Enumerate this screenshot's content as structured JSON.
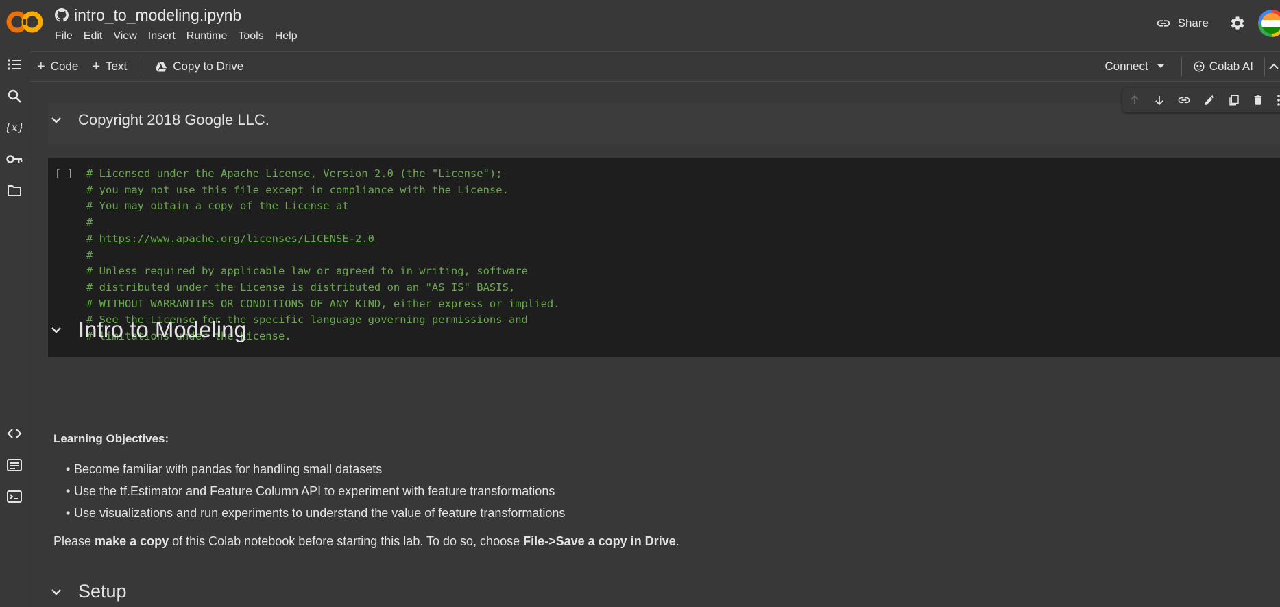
{
  "app": {
    "notebook_title": "intro_to_modeling.ipynb",
    "logo_text": "CO",
    "menu": [
      "File",
      "Edit",
      "View",
      "Insert",
      "Runtime",
      "Tools",
      "Help"
    ],
    "share_label": "Share"
  },
  "toolbar": {
    "code_label": "Code",
    "text_label": "Text",
    "copy_to_drive_label": "Copy to Drive",
    "connect_label": "Connect",
    "colab_ai_label": "Colab AI"
  },
  "rail": [
    "table-of-contents-icon",
    "search-icon",
    "variables-icon",
    "secrets-key-icon",
    "files-folder-icon",
    "code-snippets-icon",
    "command-palette-icon",
    "terminal-icon"
  ],
  "cells": {
    "copyright_heading": "Copyright 2018 Google LLC.",
    "run_indicator": "[ ]",
    "code_lines": [
      "# Licensed under the Apache License, Version 2.0 (the \"License\");",
      "# you may not use this file except in compliance with the License.",
      "# You may obtain a copy of the License at",
      "#",
      "# https://www.apache.org/licenses/LICENSE-2.0",
      "#",
      "# Unless required by applicable law or agreed to in writing, software",
      "# distributed under the License is distributed on an \"AS IS\" BASIS,",
      "# WITHOUT WARRANTIES OR CONDITIONS OF ANY KIND, either express or implied.",
      "# See the License for the specific language governing permissions and",
      "# limitations under the License."
    ],
    "intro_heading": "Intro to Modeling",
    "objectives_label": "Learning Objectives:",
    "objectives": [
      "Become familiar with pandas for handling small datasets",
      "Use the tf.Estimator and Feature Column API to experiment with feature transformations",
      "Use visualizations and run experiments to understand the value of feature transformations"
    ],
    "copy_note": {
      "p1": "Please ",
      "b1": "make a copy",
      "p2": " of this Colab notebook before starting this lab. To do so, choose ",
      "b2": "File->Save a copy in Drive",
      "p3": "."
    },
    "setup_heading": "Setup"
  },
  "colors": {
    "background": "#383838",
    "code_bg": "#1e1e1e",
    "code_comment": "#6aa84f",
    "logo_orange": "#f9ab00",
    "logo_dark_orange": "#e8710a"
  }
}
